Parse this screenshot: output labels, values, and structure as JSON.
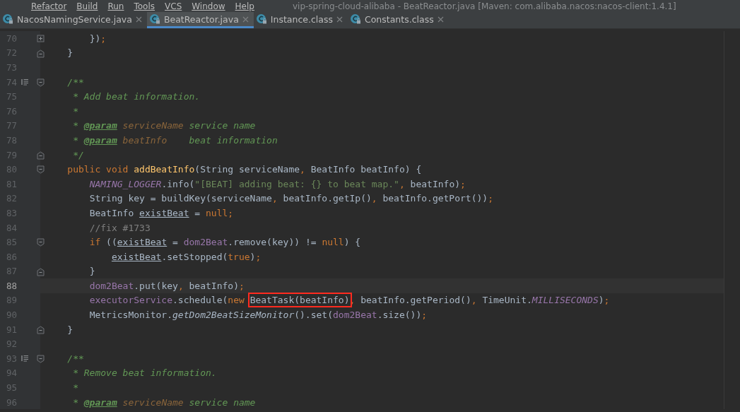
{
  "menu": [
    {
      "label": "Refactor"
    },
    {
      "label": "Build"
    },
    {
      "label": "Run"
    },
    {
      "label": "Tools"
    },
    {
      "label": "VCS"
    },
    {
      "label": "Window"
    },
    {
      "label": "Help"
    }
  ],
  "window": {
    "title": "vip-spring-cloud-alibaba - BeatReactor.java [Maven: com.alibaba.nacos:nacos-client:1.4.1]"
  },
  "tabs": [
    {
      "label": "NacosNamingService.java",
      "selected": false
    },
    {
      "label": "BeatReactor.java",
      "selected": true
    },
    {
      "label": "Instance.class",
      "selected": false
    },
    {
      "label": "Constants.class",
      "selected": false
    }
  ],
  "lines": [
    {
      "number": "70",
      "folded": true,
      "tokens": [
        {
          "text": "        })",
          "kind": "plain"
        },
        {
          "text": ";",
          "kind": "keyword"
        }
      ]
    },
    {
      "number": "72",
      "fold_end": true,
      "tokens": [
        {
          "text": "    }",
          "kind": "plain"
        }
      ]
    },
    {
      "number": "73"
    },
    {
      "number": "74",
      "fold_start": true,
      "doc_icon": true,
      "tokens": [
        {
          "text": "    /**",
          "kind": "doc"
        }
      ]
    },
    {
      "number": "75",
      "tokens": [
        {
          "text": "     * Add beat information.",
          "kind": "doc"
        }
      ]
    },
    {
      "number": "76",
      "tokens": [
        {
          "text": "     *",
          "kind": "doc"
        }
      ]
    },
    {
      "number": "77",
      "tokens": [
        {
          "text": "     * ",
          "kind": "doc"
        },
        {
          "text": "@param",
          "kind": "doctag"
        },
        {
          "text": " serviceName",
          "kind": "docparam"
        },
        {
          "text": " service name",
          "kind": "doc"
        }
      ]
    },
    {
      "number": "78",
      "tokens": [
        {
          "text": "     * ",
          "kind": "doc"
        },
        {
          "text": "@param",
          "kind": "doctag"
        },
        {
          "text": " beatInfo",
          "kind": "docparam"
        },
        {
          "text": "    beat information",
          "kind": "doc"
        }
      ]
    },
    {
      "number": "79",
      "fold_end": true,
      "tokens": [
        {
          "text": "     */",
          "kind": "doc"
        }
      ]
    },
    {
      "number": "80",
      "fold_start": true,
      "tokens": [
        {
          "text": "    public void ",
          "kind": "keyword"
        },
        {
          "text": "addBeatInfo",
          "kind": "decl"
        },
        {
          "text": "(String serviceName",
          "kind": "plain"
        },
        {
          "text": ",",
          "kind": "keyword"
        },
        {
          "text": " BeatInfo beatInfo) {",
          "kind": "plain"
        }
      ]
    },
    {
      "number": "81",
      "tokens": [
        {
          "text": "        NAMING_LOGGER",
          "kind": "static"
        },
        {
          "text": ".info(",
          "kind": "plain"
        },
        {
          "text": "\"[BEAT] adding beat: {} to beat map.\"",
          "kind": "string"
        },
        {
          "text": ",",
          "kind": "keyword"
        },
        {
          "text": " beatInfo)",
          "kind": "plain"
        },
        {
          "text": ";",
          "kind": "keyword"
        }
      ]
    },
    {
      "number": "82",
      "tokens": [
        {
          "text": "        String key = buildKey(serviceName",
          "kind": "plain"
        },
        {
          "text": ",",
          "kind": "keyword"
        },
        {
          "text": " beatInfo.getIp()",
          "kind": "plain"
        },
        {
          "text": ",",
          "kind": "keyword"
        },
        {
          "text": " beatInfo.getPort())",
          "kind": "plain"
        },
        {
          "text": ";",
          "kind": "keyword"
        }
      ]
    },
    {
      "number": "83",
      "tokens": [
        {
          "text": "        BeatInfo ",
          "kind": "plain"
        },
        {
          "text": "existBeat",
          "kind": "underlined"
        },
        {
          "text": " = ",
          "kind": "plain"
        },
        {
          "text": "null;",
          "kind": "keyword"
        }
      ]
    },
    {
      "number": "84",
      "tokens": [
        {
          "text": "        //fix #1733",
          "kind": "comment"
        }
      ]
    },
    {
      "number": "85",
      "fold_start": true,
      "tokens": [
        {
          "text": "        if",
          "kind": "keyword"
        },
        {
          "text": " ((",
          "kind": "plain"
        },
        {
          "text": "existBeat",
          "kind": "underlined"
        },
        {
          "text": " = ",
          "kind": "plain"
        },
        {
          "text": "dom2Beat",
          "kind": "field"
        },
        {
          "text": ".remove(key)) != ",
          "kind": "plain"
        },
        {
          "text": "null",
          "kind": "keyword"
        },
        {
          "text": ") {",
          "kind": "plain"
        }
      ]
    },
    {
      "number": "86",
      "tokens": [
        {
          "text": "            existBeat",
          "kind": "underlined"
        },
        {
          "text": ".setStopped(",
          "kind": "plain"
        },
        {
          "text": "true",
          "kind": "keyword"
        },
        {
          "text": ")",
          "kind": "plain"
        },
        {
          "text": ";",
          "kind": "keyword"
        }
      ]
    },
    {
      "number": "87",
      "fold_end": true,
      "tokens": [
        {
          "text": "        }",
          "kind": "plain"
        }
      ]
    },
    {
      "number": "88",
      "current": true,
      "tokens": [
        {
          "text": "        dom2Beat",
          "kind": "field"
        },
        {
          "text": ".put(key",
          "kind": "plain"
        },
        {
          "text": ",",
          "kind": "keyword"
        },
        {
          "text": " beatInfo)",
          "kind": "plain"
        },
        {
          "text": ";",
          "kind": "keyword"
        }
      ]
    },
    {
      "number": "89",
      "tokens": [
        {
          "text": "        executorService",
          "kind": "field"
        },
        {
          "text": ".schedule(",
          "kind": "plain"
        },
        {
          "text": "new",
          "kind": "keyword"
        },
        {
          "text": " BeatTask(beatInfo)",
          "kind": "plain",
          "boxed": true
        },
        {
          "text": ",",
          "kind": "keyword"
        },
        {
          "text": " beatInfo.getPeriod()",
          "kind": "plain"
        },
        {
          "text": ",",
          "kind": "keyword"
        },
        {
          "text": " TimeUnit.",
          "kind": "plain"
        },
        {
          "text": "MILLISECONDS",
          "kind": "static"
        },
        {
          "text": ")",
          "kind": "plain"
        },
        {
          "text": ";",
          "kind": "keyword"
        }
      ]
    },
    {
      "number": "90",
      "tokens": [
        {
          "text": "        MetricsMonitor.",
          "kind": "plain"
        },
        {
          "text": "getDom2BeatSizeMonitor",
          "kind": "staticmethod"
        },
        {
          "text": "().set(",
          "kind": "plain"
        },
        {
          "text": "dom2Beat",
          "kind": "field"
        },
        {
          "text": ".size())",
          "kind": "plain"
        },
        {
          "text": ";",
          "kind": "keyword"
        }
      ]
    },
    {
      "number": "91",
      "fold_end": true,
      "tokens": [
        {
          "text": "    }",
          "kind": "plain"
        }
      ]
    },
    {
      "number": "92"
    },
    {
      "number": "93",
      "fold_start": true,
      "doc_icon": true,
      "tokens": [
        {
          "text": "    /**",
          "kind": "doc"
        }
      ]
    },
    {
      "number": "94",
      "tokens": [
        {
          "text": "     * Remove beat information.",
          "kind": "doc"
        }
      ]
    },
    {
      "number": "95",
      "tokens": [
        {
          "text": "     *",
          "kind": "doc"
        }
      ]
    },
    {
      "number": "96",
      "tokens": [
        {
          "text": "     * ",
          "kind": "doc"
        },
        {
          "text": "@param",
          "kind": "doctag"
        },
        {
          "text": " serviceName",
          "kind": "docparam"
        },
        {
          "text": " service name",
          "kind": "doc"
        }
      ]
    }
  ]
}
